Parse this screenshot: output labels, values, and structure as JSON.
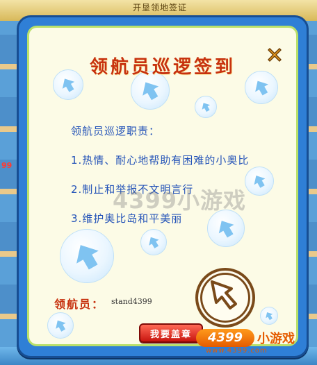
{
  "background": {
    "top_text": "开垦领地签证",
    "left_badge": "99"
  },
  "dialog": {
    "title": "领航员巡逻签到",
    "duties_heading": "领航员巡逻职责：",
    "duties": [
      "1.热情、耐心地帮助有困难的小奥比",
      "2.制止和举报不文明言行",
      "3.维护奥比岛和平美丽"
    ],
    "navigator_label": "领航员：",
    "navigator_name": "stand4399",
    "sign_button": "我要盖章",
    "close_icon": "close-icon"
  },
  "watermark": {
    "center_text": "4399小游戏",
    "logo_number": "4399",
    "logo_text": "小游戏",
    "logo_url": "www.4399.com"
  },
  "colors": {
    "frame_blue": "#2f7fd6",
    "panel_cream": "#fcfbe6",
    "title_red": "#c7320f",
    "text_blue": "#2453b8",
    "button_red": "#c8150f",
    "logo_orange": "#e55b00"
  }
}
